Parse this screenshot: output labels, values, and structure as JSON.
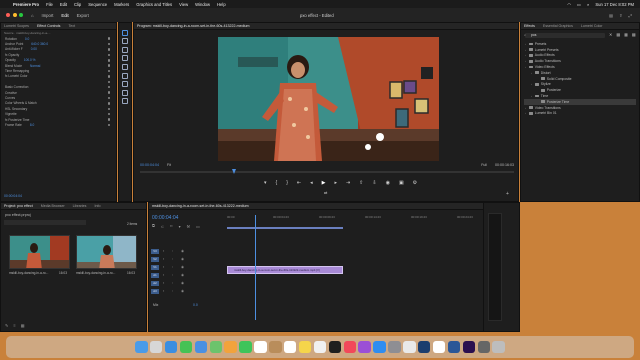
{
  "menubar": {
    "app": "Premiere Pro",
    "items": [
      "File",
      "Edit",
      "Clip",
      "Sequence",
      "Markers",
      "Graphics and Titles",
      "View",
      "Window",
      "Help"
    ],
    "clock": "Sun 17 Dec  8:02 PM"
  },
  "app_header": {
    "nav": [
      "Import",
      "Edit",
      "Export"
    ],
    "title": "pxo effect - Edited"
  },
  "effect_controls": {
    "tabs": [
      "Lumetri Scopes",
      "Effect Controls",
      "Text"
    ],
    "source": "Source · mskill-boy-dancing-in-a-...",
    "rows": [
      {
        "label": "Rotation",
        "value": "0.0"
      },
      {
        "label": "Anchor Point",
        "value": "640.0    360.0"
      },
      {
        "label": "Anti-flicker F",
        "value": "0.00"
      },
      {
        "label": "fx Opacity",
        "value": ""
      },
      {
        "label": "Opacity",
        "value": "100.0 %"
      },
      {
        "label": "Blend Mode",
        "value": "Normal"
      },
      {
        "label": "Time Remapping",
        "value": ""
      },
      {
        "label": "fx Lumetri Color",
        "value": ""
      },
      {
        "label": "",
        "value": ""
      },
      {
        "label": "Basic Correction",
        "value": ""
      },
      {
        "label": "Creative",
        "value": ""
      },
      {
        "label": "Curves",
        "value": ""
      },
      {
        "label": "Color Wheels & Match",
        "value": ""
      },
      {
        "label": "HSL Secondary",
        "value": ""
      },
      {
        "label": "Vignette",
        "value": ""
      },
      {
        "label": "fx Posterize Time",
        "value": ""
      },
      {
        "label": "Frame Rate",
        "value": "8.0"
      }
    ],
    "timecode": "00:00:04:04"
  },
  "program_monitor": {
    "title": "Program: mskill-boy-dancing-in-a-room-set-in-the-60s-413222-medium",
    "timecode_left": "00:00:04:04",
    "fit": "Fit",
    "resolution": "Full",
    "timecode_right": "00:00:16:03"
  },
  "effects_panel": {
    "tabs": [
      "Effects",
      "Essential Graphics",
      "Lumetri Color"
    ],
    "search_value": "pos",
    "items": [
      {
        "label": "Presets",
        "indent": 0
      },
      {
        "label": "Lumetri Presets",
        "indent": 0
      },
      {
        "label": "Audio Effects",
        "indent": 0
      },
      {
        "label": "Audio Transitions",
        "indent": 0
      },
      {
        "label": "Video Effects",
        "indent": 0
      },
      {
        "label": "Distort",
        "indent": 1
      },
      {
        "label": "Solid Composite",
        "indent": 2
      },
      {
        "label": "Stylize",
        "indent": 1
      },
      {
        "label": "Posterize",
        "indent": 2
      },
      {
        "label": "Time",
        "indent": 1
      },
      {
        "label": "Posterize Time",
        "indent": 2
      },
      {
        "label": "Video Transitions",
        "indent": 0
      },
      {
        "label": "Lumetri Bin 01",
        "indent": 0
      }
    ]
  },
  "project_panel": {
    "tabs": [
      "Project: pxo effect",
      "Media Browser",
      "Libraries",
      "Info"
    ],
    "project_file": "pxo effect.prproj",
    "item_count": "2 items",
    "clips": [
      {
        "name": "mskill-boy-dancing-in-a-ro...",
        "duration": "16:03"
      },
      {
        "name": "mskill-boy-dancing-in-a-ro...",
        "duration": "16:03"
      }
    ]
  },
  "timeline": {
    "sequence_name": "mskill-boy-dancing-in-a-room-set-in-the-60s-413222-medium",
    "timecode": "00:00:04:04",
    "ruler": [
      "00:00",
      "00:00:04:23",
      "00:00:09:23",
      "00:00:14:23",
      "00:00:19:23",
      "00:00:24:23",
      "00:00:29:23"
    ],
    "video_tracks": [
      "V3",
      "V2",
      "V1"
    ],
    "audio_tracks": [
      "A1",
      "A2",
      "A3"
    ],
    "mix_label": "Mix",
    "mix_value": "0.0",
    "clip_label": "mskill-boy-dancing-in-a-room-set-in-the-60s-413222-medium.mp4 [V]"
  },
  "colors": {
    "accent_blue": "#4d8fe0",
    "clip_purple": "#a88ad6"
  },
  "dock": {
    "icons": [
      "finder-icon",
      "launchpad-icon",
      "safari-icon",
      "messages-icon",
      "mail-icon",
      "maps-icon",
      "photos-icon",
      "facetime-icon",
      "calendar-icon",
      "contacts-icon",
      "reminders-icon",
      "notes-icon",
      "freeform-icon",
      "tv-icon",
      "music-icon",
      "podcasts-icon",
      "appstore-icon",
      "settings-icon",
      "chrome-icon",
      "photoshop-icon",
      "notion-icon",
      "word-icon",
      "premiere-icon",
      "other-icon",
      "trash-icon"
    ]
  }
}
